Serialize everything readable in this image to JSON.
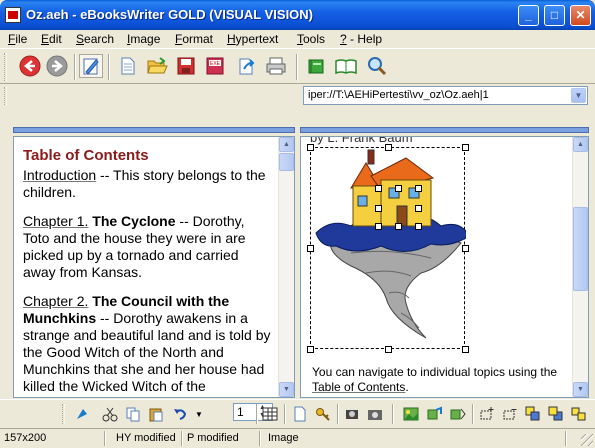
{
  "window": {
    "title": "Oz.aeh - eBooksWriter GOLD (VISUAL VISION)",
    "controls": [
      "_",
      "□",
      "✕"
    ]
  },
  "menu": [
    {
      "label": "File",
      "underline": "F",
      "rest": "ile"
    },
    {
      "label": "Edit",
      "underline": "E",
      "rest": "dit"
    },
    {
      "label": "Search",
      "underline": "S",
      "rest": "earch"
    },
    {
      "label": "Image",
      "underline": "I",
      "rest": "mage"
    },
    {
      "label": "Format",
      "underline": "F",
      "rest": "ormat"
    },
    {
      "label": "Hypertext",
      "underline": "H",
      "rest": "ypertext"
    },
    {
      "label": "Tools",
      "underline": "T",
      "rest": "ools"
    },
    {
      "label": "? - Help",
      "underline": "?",
      "rest": " - Help"
    }
  ],
  "address": {
    "value": "iper://T:\\AEHiPertesti\\vv_oz\\Oz.aeh|1"
  },
  "left_pane": {
    "heading": "Table of Contents",
    "intro_link": "Introduction",
    "intro_text": " -- This story belongs to the children.",
    "ch1_link": "Chapter 1.",
    "ch1_title": " The Cyclone",
    "ch1_text": " -- Dorothy, Toto and the house they were in are picked up by a tornado and carried away from Kansas.",
    "ch2_link": "Chapter 2.",
    "ch2_title": " The Council with the Munchkins",
    "ch2_text": " -- Dorothy awakens in a strange and beautiful land and is told by the Good Witch of the North and Munchkins that she and her house had killed the Wicked Witch of the"
  },
  "right_pane": {
    "author_cut": "by L. Frank Baum",
    "text_before": "You can navigate to individual topics using the ",
    "toc_link": "Table of Contents",
    "text_after": "."
  },
  "bottom_toolbar": {
    "spin_value": "1"
  },
  "status": {
    "size": "157x200",
    "hy": "HY modified",
    "p": "P modified",
    "mode": "Image"
  }
}
